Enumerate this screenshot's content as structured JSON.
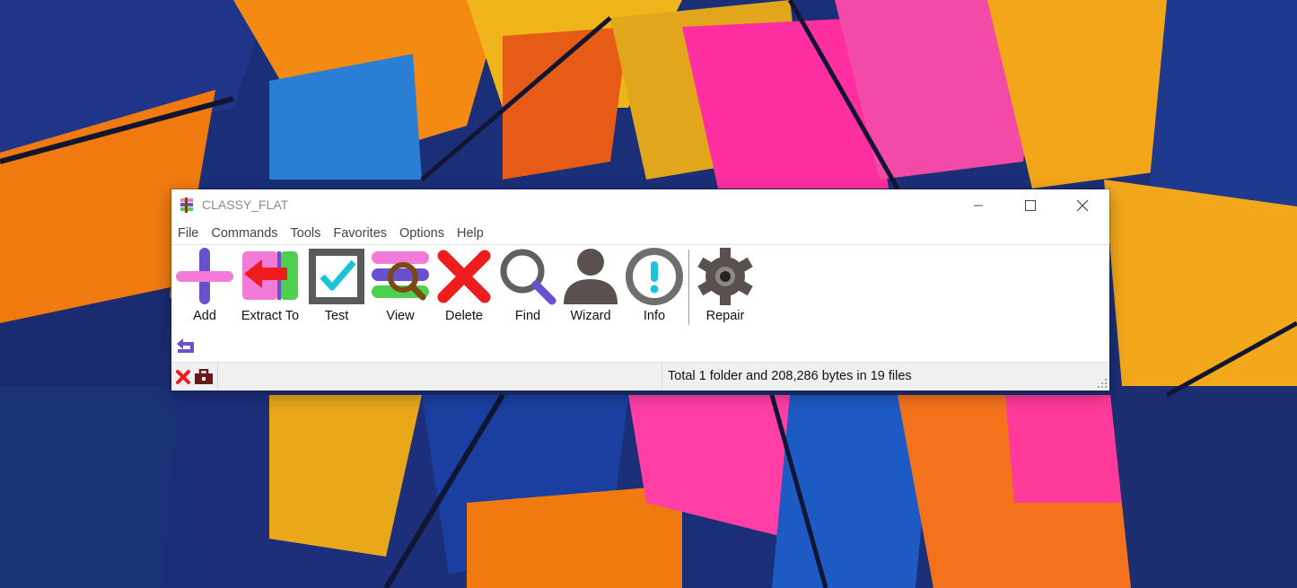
{
  "window": {
    "title": "CLASSY_FLAT",
    "minimize": "minimize",
    "maximize": "maximize",
    "close": "close"
  },
  "menu": [
    "File",
    "Commands",
    "Tools",
    "Favorites",
    "Options",
    "Help"
  ],
  "toolbar": {
    "add": "Add",
    "extract": "Extract To",
    "test": "Test",
    "view": "View",
    "delete": "Delete",
    "find": "Find",
    "wizard": "Wizard",
    "info": "Info",
    "repair": "Repair"
  },
  "status": {
    "summary": "Total 1 folder and 208,286 bytes in 19 files"
  },
  "colors": {
    "accent_purple": "#6a4fcf",
    "pink": "#f27ad8",
    "red": "#ee1c1c",
    "green": "#4fcf4f",
    "brown": "#7a4a12",
    "dark_gray": "#5a5050",
    "teal": "#1cc3d6"
  }
}
